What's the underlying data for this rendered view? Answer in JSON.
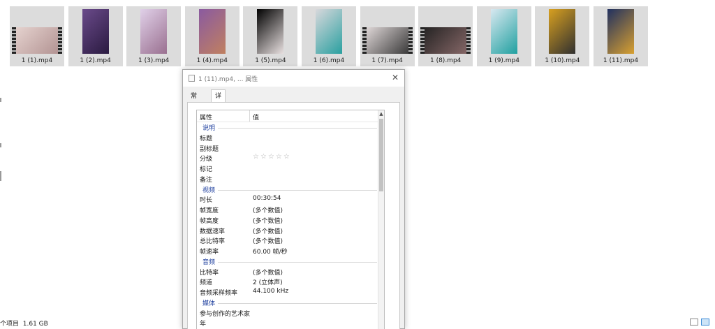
{
  "files": [
    {
      "name": "1 (1).mp4",
      "orientation": "wide",
      "colors": [
        "#e8d6d2",
        "#b09090"
      ]
    },
    {
      "name": "1 (2).mp4",
      "orientation": "tall",
      "colors": [
        "#6a4a8a",
        "#2a1a40"
      ]
    },
    {
      "name": "1 (3).mp4",
      "orientation": "tall",
      "colors": [
        "#e0d0e8",
        "#9a7090"
      ]
    },
    {
      "name": "1 (4).mp4",
      "orientation": "tall",
      "colors": [
        "#8a5aa0",
        "#c08060"
      ]
    },
    {
      "name": "1 (5).mp4",
      "orientation": "tall",
      "colors": [
        "#000000",
        "#e8e0e0"
      ]
    },
    {
      "name": "1 (6).mp4",
      "orientation": "tall",
      "colors": [
        "#d8d8dc",
        "#2aa0a0"
      ]
    },
    {
      "name": "1 (7).mp4",
      "orientation": "wide",
      "colors": [
        "#e8e0e0",
        "#303030"
      ]
    },
    {
      "name": "1 (8).mp4",
      "orientation": "wide",
      "colors": [
        "#202020",
        "#8a6a6a"
      ]
    },
    {
      "name": "1 (9).mp4",
      "orientation": "tall",
      "colors": [
        "#d8e8f0",
        "#20a0a0"
      ]
    },
    {
      "name": "1 (10).mp4",
      "orientation": "tall",
      "colors": [
        "#d8a020",
        "#303030"
      ]
    },
    {
      "name": "1 (11).mp4",
      "orientation": "tall",
      "colors": [
        "#203060",
        "#d8a030"
      ]
    }
  ],
  "status": {
    "count_label": "个项目",
    "size": "1.61 GB"
  },
  "dialog": {
    "title": "1 (11).mp4, ... 属性",
    "close_glyph": "✕",
    "tabs": [
      {
        "label": "常规",
        "active": false
      },
      {
        "label": "详细信息",
        "active": true
      }
    ],
    "columns": {
      "property": "属性",
      "value": "值"
    },
    "rating_stars": "☆☆☆☆☆",
    "groups": [
      {
        "name": "说明",
        "rows": [
          {
            "name": "标题",
            "value": ""
          },
          {
            "name": "副标题",
            "value": ""
          },
          {
            "name": "分级",
            "value": "",
            "rating": true
          },
          {
            "name": "标记",
            "value": ""
          },
          {
            "name": "备注",
            "value": ""
          }
        ]
      },
      {
        "name": "视频",
        "rows": [
          {
            "name": "时长",
            "value": "00:30:54"
          },
          {
            "name": "帧宽度",
            "value": "(多个数值)"
          },
          {
            "name": "帧高度",
            "value": "(多个数值)"
          },
          {
            "name": "数据速率",
            "value": "(多个数值)"
          },
          {
            "name": "总比特率",
            "value": "(多个数值)"
          },
          {
            "name": "帧速率",
            "value": "60.00 帧/秒"
          }
        ]
      },
      {
        "name": "音频",
        "rows": [
          {
            "name": "比特率",
            "value": "(多个数值)"
          },
          {
            "name": "频道",
            "value": "2 (立体声)"
          },
          {
            "name": "音频采样频率",
            "value": "44.100 kHz"
          }
        ]
      },
      {
        "name": "媒体",
        "rows": [
          {
            "name": "参与创作的艺术家",
            "value": ""
          },
          {
            "name": "年",
            "value": ""
          }
        ]
      }
    ]
  }
}
